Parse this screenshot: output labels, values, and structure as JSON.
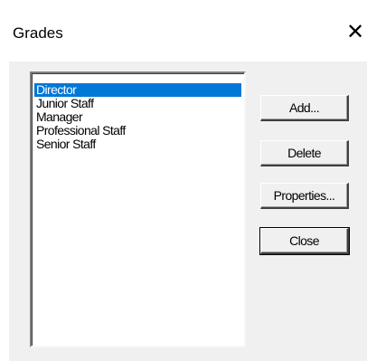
{
  "window": {
    "title": "Grades",
    "close_glyph": "✕"
  },
  "grades_list": {
    "items": [
      "Director",
      "Junior Staff",
      "Manager",
      "Professional Staff",
      "Senior Staff"
    ],
    "selected": "Director"
  },
  "buttons": {
    "add": "Add...",
    "delete": "Delete",
    "properties": "Properties...",
    "close": "Close"
  },
  "colors": {
    "selection": "#0078d7",
    "dialog_face": "#f0f0f0"
  }
}
